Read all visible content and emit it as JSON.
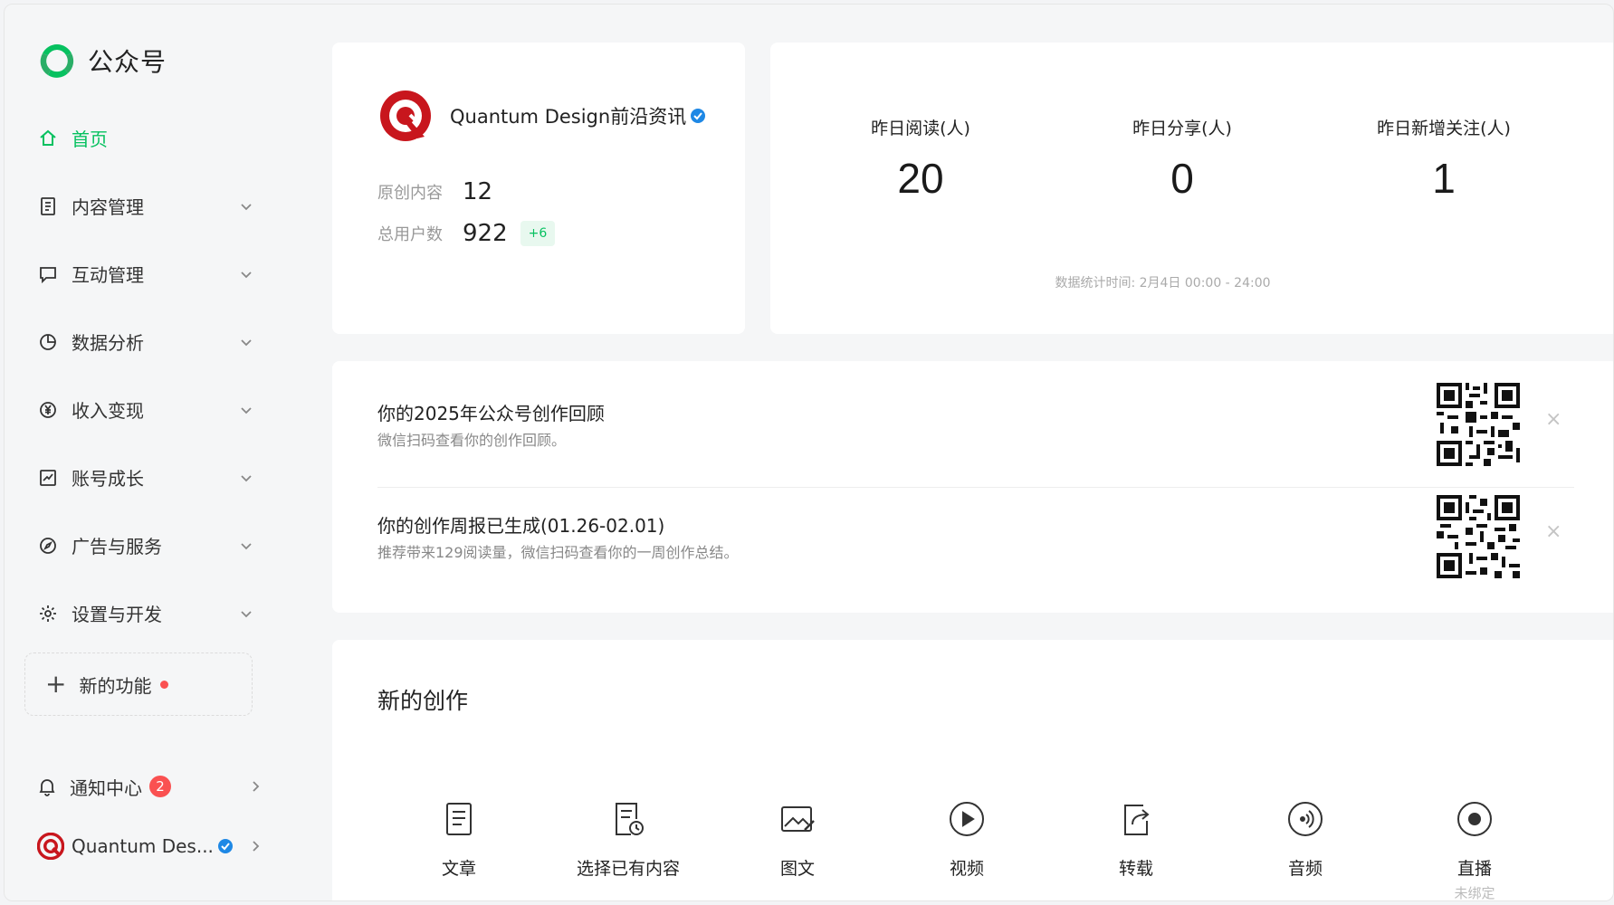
{
  "app": {
    "title": "公众号"
  },
  "sidebar": {
    "items": [
      {
        "label": "首页",
        "icon": "home-icon",
        "active": true
      },
      {
        "label": "内容管理",
        "icon": "document-icon"
      },
      {
        "label": "互动管理",
        "icon": "chat-icon"
      },
      {
        "label": "数据分析",
        "icon": "pie-chart-icon"
      },
      {
        "label": "收入变现",
        "icon": "yen-icon"
      },
      {
        "label": "账号成长",
        "icon": "growth-chart-icon"
      },
      {
        "label": "广告与服务",
        "icon": "compass-icon"
      },
      {
        "label": "设置与开发",
        "icon": "gear-icon"
      }
    ],
    "new_feature": "新的功能",
    "notification": {
      "label": "通知中心",
      "count": "2"
    },
    "account_short": "Quantum Des..."
  },
  "account": {
    "name": "Quantum Design前沿资讯",
    "original_label": "原创内容",
    "original_value": "12",
    "users_label": "总用户数",
    "users_value": "922",
    "users_delta": "+6"
  },
  "stats": {
    "reads_label": "昨日阅读(人)",
    "reads_value": "20",
    "shares_label": "昨日分享(人)",
    "shares_value": "0",
    "follows_label": "昨日新增关注(人)",
    "follows_value": "1",
    "note": "数据统计时间: 2月4日 00:00 - 24:00"
  },
  "notices": [
    {
      "title": "你的2025年公众号创作回顾",
      "desc": "微信扫码查看你的创作回顾。"
    },
    {
      "title": "你的创作周报已生成(01.26-02.01)",
      "desc": "推荐带来129阅读量，微信扫码查看你的一周创作总结。"
    }
  ],
  "create": {
    "title": "新的创作",
    "items": [
      {
        "label": "文章",
        "icon": "article-icon"
      },
      {
        "label": "选择已有内容",
        "icon": "existing-content-icon"
      },
      {
        "label": "图文",
        "icon": "image-text-icon"
      },
      {
        "label": "视频",
        "icon": "video-icon"
      },
      {
        "label": "转载",
        "icon": "repost-icon"
      },
      {
        "label": "音频",
        "icon": "audio-icon"
      },
      {
        "label": "直播",
        "icon": "live-icon",
        "sub": "未绑定"
      }
    ]
  },
  "colors": {
    "accent": "#07c160",
    "badge": "#fa5151",
    "brand_red": "#c8161d",
    "verify_blue": "#1e88e5"
  }
}
